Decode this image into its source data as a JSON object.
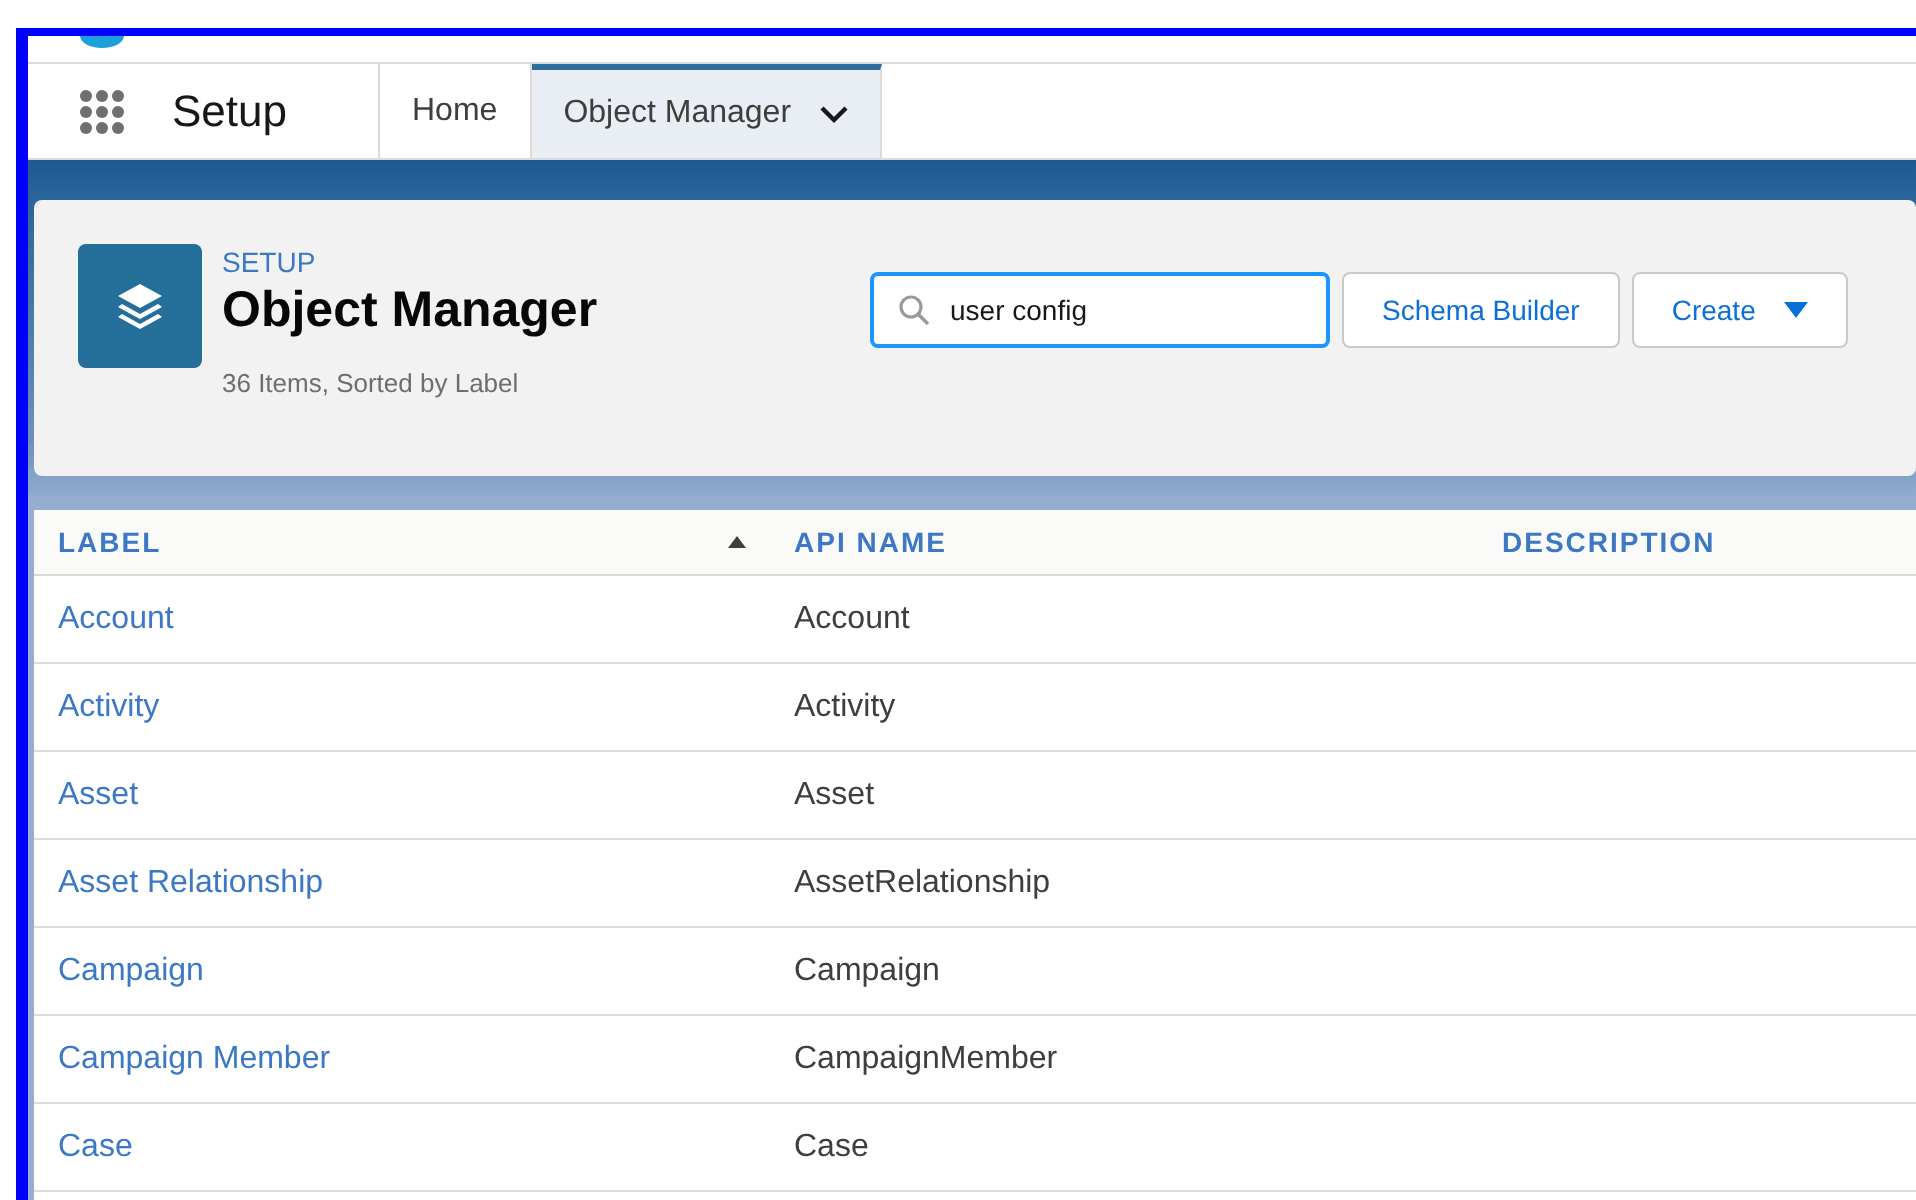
{
  "nav": {
    "app_name": "Setup",
    "tabs": [
      {
        "label": "Home",
        "selected": false,
        "menu": false
      },
      {
        "label": "Object Manager",
        "selected": true,
        "menu": true
      }
    ]
  },
  "header": {
    "breadcrumb": "SETUP",
    "title": "Object Manager",
    "subtitle": "36 Items, Sorted by Label",
    "search": {
      "value": "user config"
    },
    "buttons": [
      {
        "label": "Schema Builder",
        "kind": "button"
      },
      {
        "label": "Create",
        "kind": "dropdown"
      }
    ]
  },
  "table": {
    "columns": [
      {
        "label": "LABEL",
        "sorted": true
      },
      {
        "label": "API NAME",
        "sorted": false
      },
      {
        "label": "DESCRIPTION",
        "sorted": false
      }
    ],
    "rows": [
      {
        "label": "Account",
        "api_name": "Account"
      },
      {
        "label": "Activity",
        "api_name": "Activity"
      },
      {
        "label": "Asset",
        "api_name": "Asset"
      },
      {
        "label": "Asset Relationship",
        "api_name": "AssetRelationship"
      },
      {
        "label": "Campaign",
        "api_name": "Campaign"
      },
      {
        "label": "Campaign Member",
        "api_name": "CampaignMember"
      },
      {
        "label": "Case",
        "api_name": "Case"
      }
    ]
  }
}
